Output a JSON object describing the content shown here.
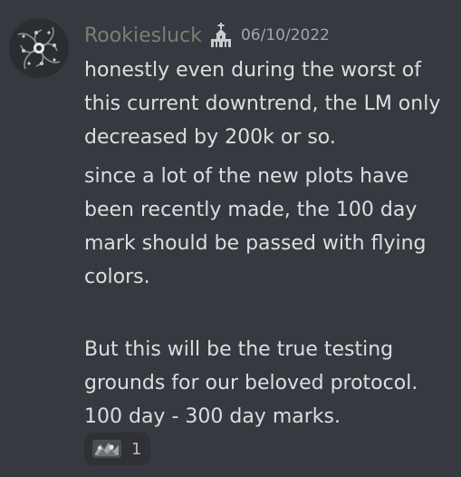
{
  "message": {
    "author": "Rookiesluck",
    "role_icon": "church-icon",
    "timestamp": "06/10/2022",
    "paragraphs": [
      "honestly even during the worst of this current downtrend, the LM only decreased by 200k or so.",
      "since a lot of the new plots have been recently made, the 100 day mark should be passed with flying colors.",
      "But this will be the true testing grounds for our beloved protocol. 100 day - 300 day marks."
    ],
    "reaction": {
      "emoji": "custom-emoji-icon",
      "count": "1"
    }
  },
  "colors": {
    "background": "#36393f",
    "username": "#7a7f73",
    "text": "#dcddde",
    "timestamp": "#a3a6aa",
    "reaction_bg": "#2f3136"
  }
}
